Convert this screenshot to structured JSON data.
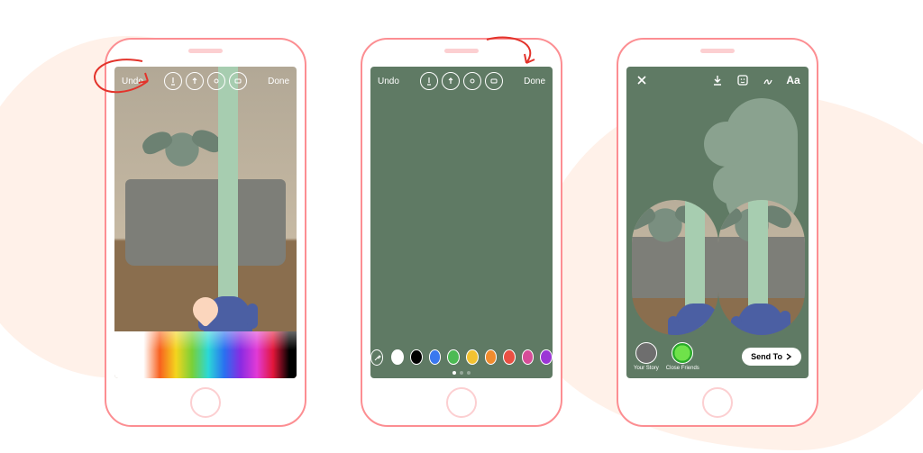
{
  "phones": {
    "phone1": {
      "toolbar": {
        "undo": "Undo",
        "done": "Done",
        "tools": [
          "marker-icon",
          "arrow-icon",
          "neon-icon",
          "eraser-icon"
        ]
      },
      "eyedropper_sample_color": "#fbd6bd"
    },
    "phone2": {
      "toolbar": {
        "undo": "Undo",
        "done": "Done",
        "tools": [
          "marker-icon",
          "arrow-icon",
          "neon-icon",
          "eraser-icon"
        ]
      },
      "fill_color": "#5f7a64",
      "swatches": [
        "#ffffff",
        "#000000",
        "#3a78ef",
        "#4cba54",
        "#f3c231",
        "#f08c2e",
        "#ea5043",
        "#d64d98",
        "#9b36d6"
      ],
      "page_dots": {
        "count": 3,
        "active_index": 0
      }
    },
    "phone3": {
      "top_icons": [
        "close-icon",
        "save-icon",
        "sticker-icon",
        "filter-icon",
        "draw-icon",
        "text-icon"
      ],
      "text_label": "Aa",
      "bottom": {
        "your_story": "Your Story",
        "close_friends": "Close Friends",
        "send_to": "Send To"
      },
      "overlay_color": "#5f7a64"
    }
  },
  "annotations": [
    "arrow-to-undo",
    "arrow-to-done"
  ]
}
